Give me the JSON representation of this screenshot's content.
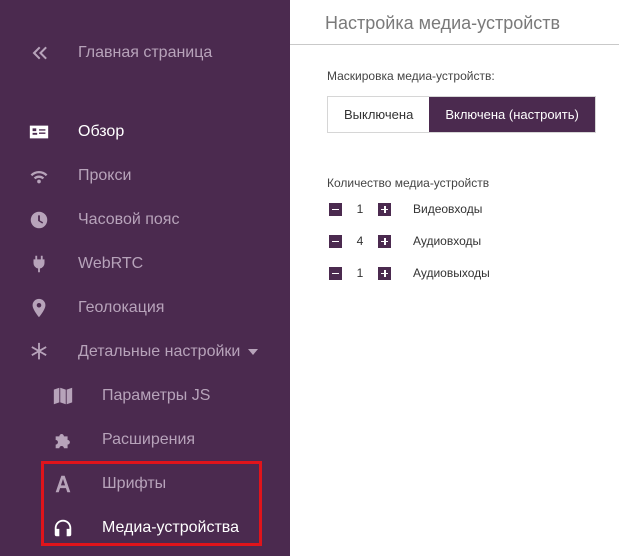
{
  "sidebar": {
    "back": {
      "label": "Главная страница",
      "icon": "double-chevron-left-icon"
    },
    "items": [
      {
        "label": "Обзор",
        "icon": "id-card-icon",
        "active": true
      },
      {
        "label": "Прокси",
        "icon": "wifi-icon"
      },
      {
        "label": "Часовой пояс",
        "icon": "clock-icon"
      },
      {
        "label": "WebRTC",
        "icon": "plug-icon"
      },
      {
        "label": "Геолокация",
        "icon": "map-marker-icon"
      },
      {
        "label": "Детальные настройки",
        "icon": "asterisk-icon",
        "expanded": true
      }
    ],
    "subitems": [
      {
        "label": "Параметры JS",
        "icon": "map-icon"
      },
      {
        "label": "Расширения",
        "icon": "puzzle-icon"
      },
      {
        "label": "Шрифты",
        "icon": "font-icon"
      },
      {
        "label": "Медиа-устройства",
        "icon": "headphones-icon",
        "active": true
      }
    ],
    "colors": {
      "background": "#4b2a4f",
      "text": "#b7a3ba",
      "active_text": "#ffffff",
      "highlight": "#e0141b"
    }
  },
  "main": {
    "title": "Настройка медиа-устройств",
    "masking": {
      "label": "Маскировка медиа-устройств:",
      "options": [
        "Выключена",
        "Включена (настроить)"
      ],
      "selected": "Включена (настроить)"
    },
    "devices": {
      "label": "Количество медиа-устройств",
      "rows": [
        {
          "count": "1",
          "name": "Видеовходы"
        },
        {
          "count": "4",
          "name": "Аудиовходы"
        },
        {
          "count": "1",
          "name": "Аудиовыходы"
        }
      ]
    }
  }
}
